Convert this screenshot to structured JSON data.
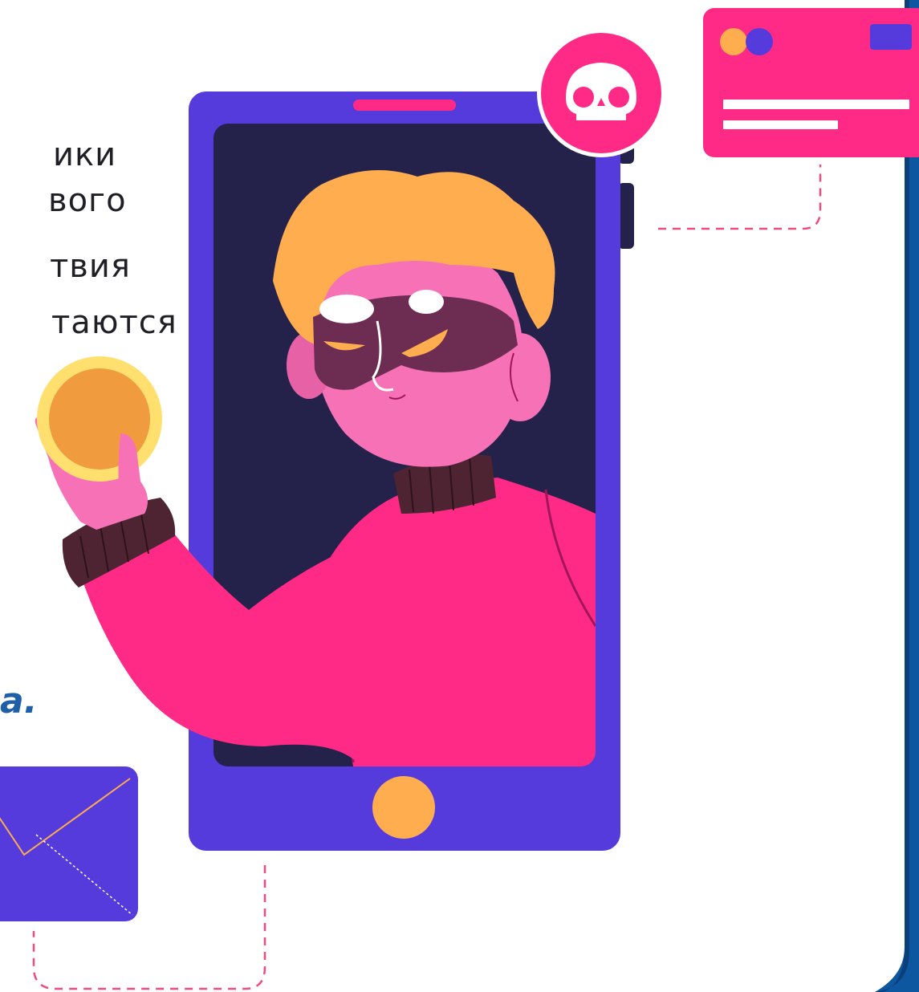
{
  "text": {
    "line1": "ики",
    "line2": "вого",
    "line3": "твия",
    "line4": "таются",
    "accent": "a."
  },
  "colors": {
    "phone": "#553bdc",
    "screen": "#24224a",
    "pink": "#ff2a86",
    "skin": "#f771b7",
    "hair": "#ffad4f",
    "mask": "#6d2c52",
    "coin": "#f09c3e",
    "coin_rim": "#ffe06e",
    "frame_blue": "#0d56a0",
    "dash": "#f04b7c"
  },
  "icons": {
    "skull": "skull-icon",
    "card": "credit-card-icon",
    "envelope": "envelope-icon",
    "coin": "coin-icon"
  }
}
